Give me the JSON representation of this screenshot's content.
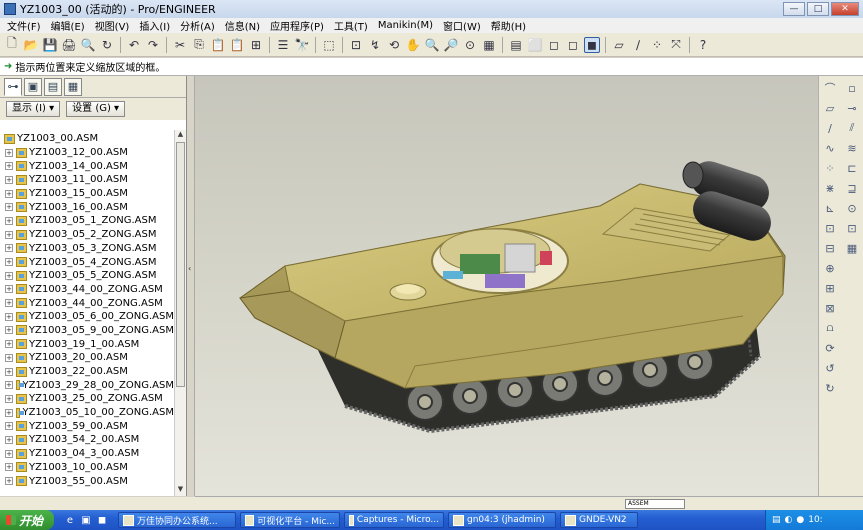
{
  "window": {
    "title": "YZ1003_00 (活动的) - Pro/ENGINEER",
    "controls": [
      "—",
      "□",
      "✕"
    ]
  },
  "menu": [
    "文件(F)",
    "编辑(E)",
    "视图(V)",
    "插入(I)",
    "分析(A)",
    "信息(N)",
    "应用程序(P)",
    "工具(T)",
    "Manikin(M)",
    "窗口(W)",
    "帮助(H)"
  ],
  "toolbar": {
    "icons": [
      "new-icon",
      "open-icon",
      "save-icon",
      "print-icon",
      "print-preview-icon",
      "regenerate-icon",
      "undo-icon",
      "redo-icon",
      "cut-icon",
      "copy-icon",
      "paste-icon",
      "paste-special-icon",
      "model-tree-icon",
      "layer-icon",
      "find-icon",
      "select-box-icon",
      "datum-display-icon",
      "spin-center-icon",
      "orient-icon",
      "pan-icon",
      "zoom-in-icon",
      "zoom-out-icon",
      "refit-icon",
      "saved-views-icon",
      "view-manager-icon",
      "wireframe-icon",
      "hidden-line-icon",
      "no-hidden-icon",
      "shading-icon",
      "datum-planes-icon",
      "datum-axes-icon",
      "datum-points-icon",
      "coordinate-systems-icon",
      "context-help-icon"
    ],
    "glyphs": [
      "🗋",
      "📂",
      "💾",
      "🖨",
      "🔍",
      "↻",
      "↶",
      "↷",
      "✂",
      "⎘",
      "📋",
      "📋",
      "⊞",
      "☰",
      "🔭",
      "⬚",
      "⊡",
      "↯",
      "⟲",
      "✋",
      "🔍",
      "🔎",
      "⊙",
      "▦",
      "▤",
      "⬜",
      "◻",
      "◻",
      "◼",
      "▱",
      "∕",
      "⁘",
      "⤧",
      "?"
    ],
    "active_index": 28
  },
  "message": {
    "text": "指示两位置来定义缩放区域的框。"
  },
  "left_panel": {
    "tabs": [
      "model-tree-tab",
      "folder-tab",
      "favorites-tab",
      "layers-tab"
    ],
    "tab_glyphs": [
      "⊶",
      "▣",
      "▤",
      "▦"
    ],
    "show_label": "显示 (I) ▾",
    "settings_label": "设置 (G) ▾"
  },
  "model_tree": {
    "root": "YZ1003_00.ASM",
    "items": [
      "YZ1003_12_00.ASM",
      "YZ1003_14_00.ASM",
      "YZ1003_11_00.ASM",
      "YZ1003_15_00.ASM",
      "YZ1003_16_00.ASM",
      "YZ1003_05_1_ZONG.ASM",
      "YZ1003_05_2_ZONG.ASM",
      "YZ1003_05_3_ZONG.ASM",
      "YZ1003_05_4_ZONG.ASM",
      "YZ1003_05_5_ZONG.ASM",
      "YZ1003_44_00_ZONG.ASM",
      "YZ1003_44_00_ZONG.ASM",
      "YZ1003_05_6_00_ZONG.ASM",
      "YZ1003_05_9_00_ZONG.ASM",
      "YZ1003_19_1_00.ASM",
      "YZ1003_20_00.ASM",
      "YZ1003_22_00.ASM",
      "YZ1003_29_28_00_ZONG.ASM",
      "YZ1003_25_00_ZONG.ASM",
      "YZ1003_05_10_00_ZONG.ASM",
      "YZ1003_59_00.ASM",
      "YZ1003_54_2_00.ASM",
      "YZ1003_04_3_00.ASM",
      "YZ1003_10_00.ASM",
      "YZ1003_55_00.ASM"
    ]
  },
  "right_toolbar": {
    "col1": [
      "sketch-icon",
      "plane-icon",
      "axis-icon",
      "curve-icon",
      "point-icon",
      "coordinate-icon",
      "analysis-icon",
      "copy-geom-icon",
      "shrinkwrap-icon",
      "component-icon",
      "assemble-icon",
      "create-component-icon",
      "mirror-icon",
      "repeat-icon",
      "pattern-icon",
      "merge-icon"
    ],
    "col1_glyphs": [
      "⌒",
      "▱",
      "∕",
      "∿",
      "⁘",
      "⋇",
      "⊾",
      "⊡",
      "⊟",
      "⊕",
      "⊞",
      "⊠",
      "⩍",
      "⟳",
      "↺",
      "↻"
    ],
    "col2": [
      "datum-plane-icon",
      "datum-axis-icon",
      "datum-curve-icon",
      "datum-point-icon",
      "datum-csys-icon",
      "datum-analysis-icon",
      "extrude-icon",
      "revolve-icon",
      "sweep-icon"
    ],
    "col2_glyphs": [
      "▫",
      "⊸",
      "⫽",
      "≋",
      "⊏",
      "⊒",
      "⊙",
      "⊡",
      "▦"
    ]
  },
  "status_field": "ASSEM",
  "taskbar": {
    "start": "开始",
    "quick_launch": [
      "e",
      "▣",
      "◼"
    ],
    "tasks": [
      {
        "label": "万佳协同办公系统..."
      },
      {
        "label": "可视化平台 - Mic..."
      },
      {
        "label": "Captures - Micro..."
      },
      {
        "label": "gn04:3 (jhadmin)"
      },
      {
        "label": "GNDE-VN2"
      }
    ],
    "clock": "10:"
  },
  "colors": {
    "hull": "#c2b46a",
    "hull_shadow": "#8d8044",
    "track": "#2e2e2a",
    "viewport_bg": "#d3d2c6",
    "taskbar": "#245ed0"
  }
}
